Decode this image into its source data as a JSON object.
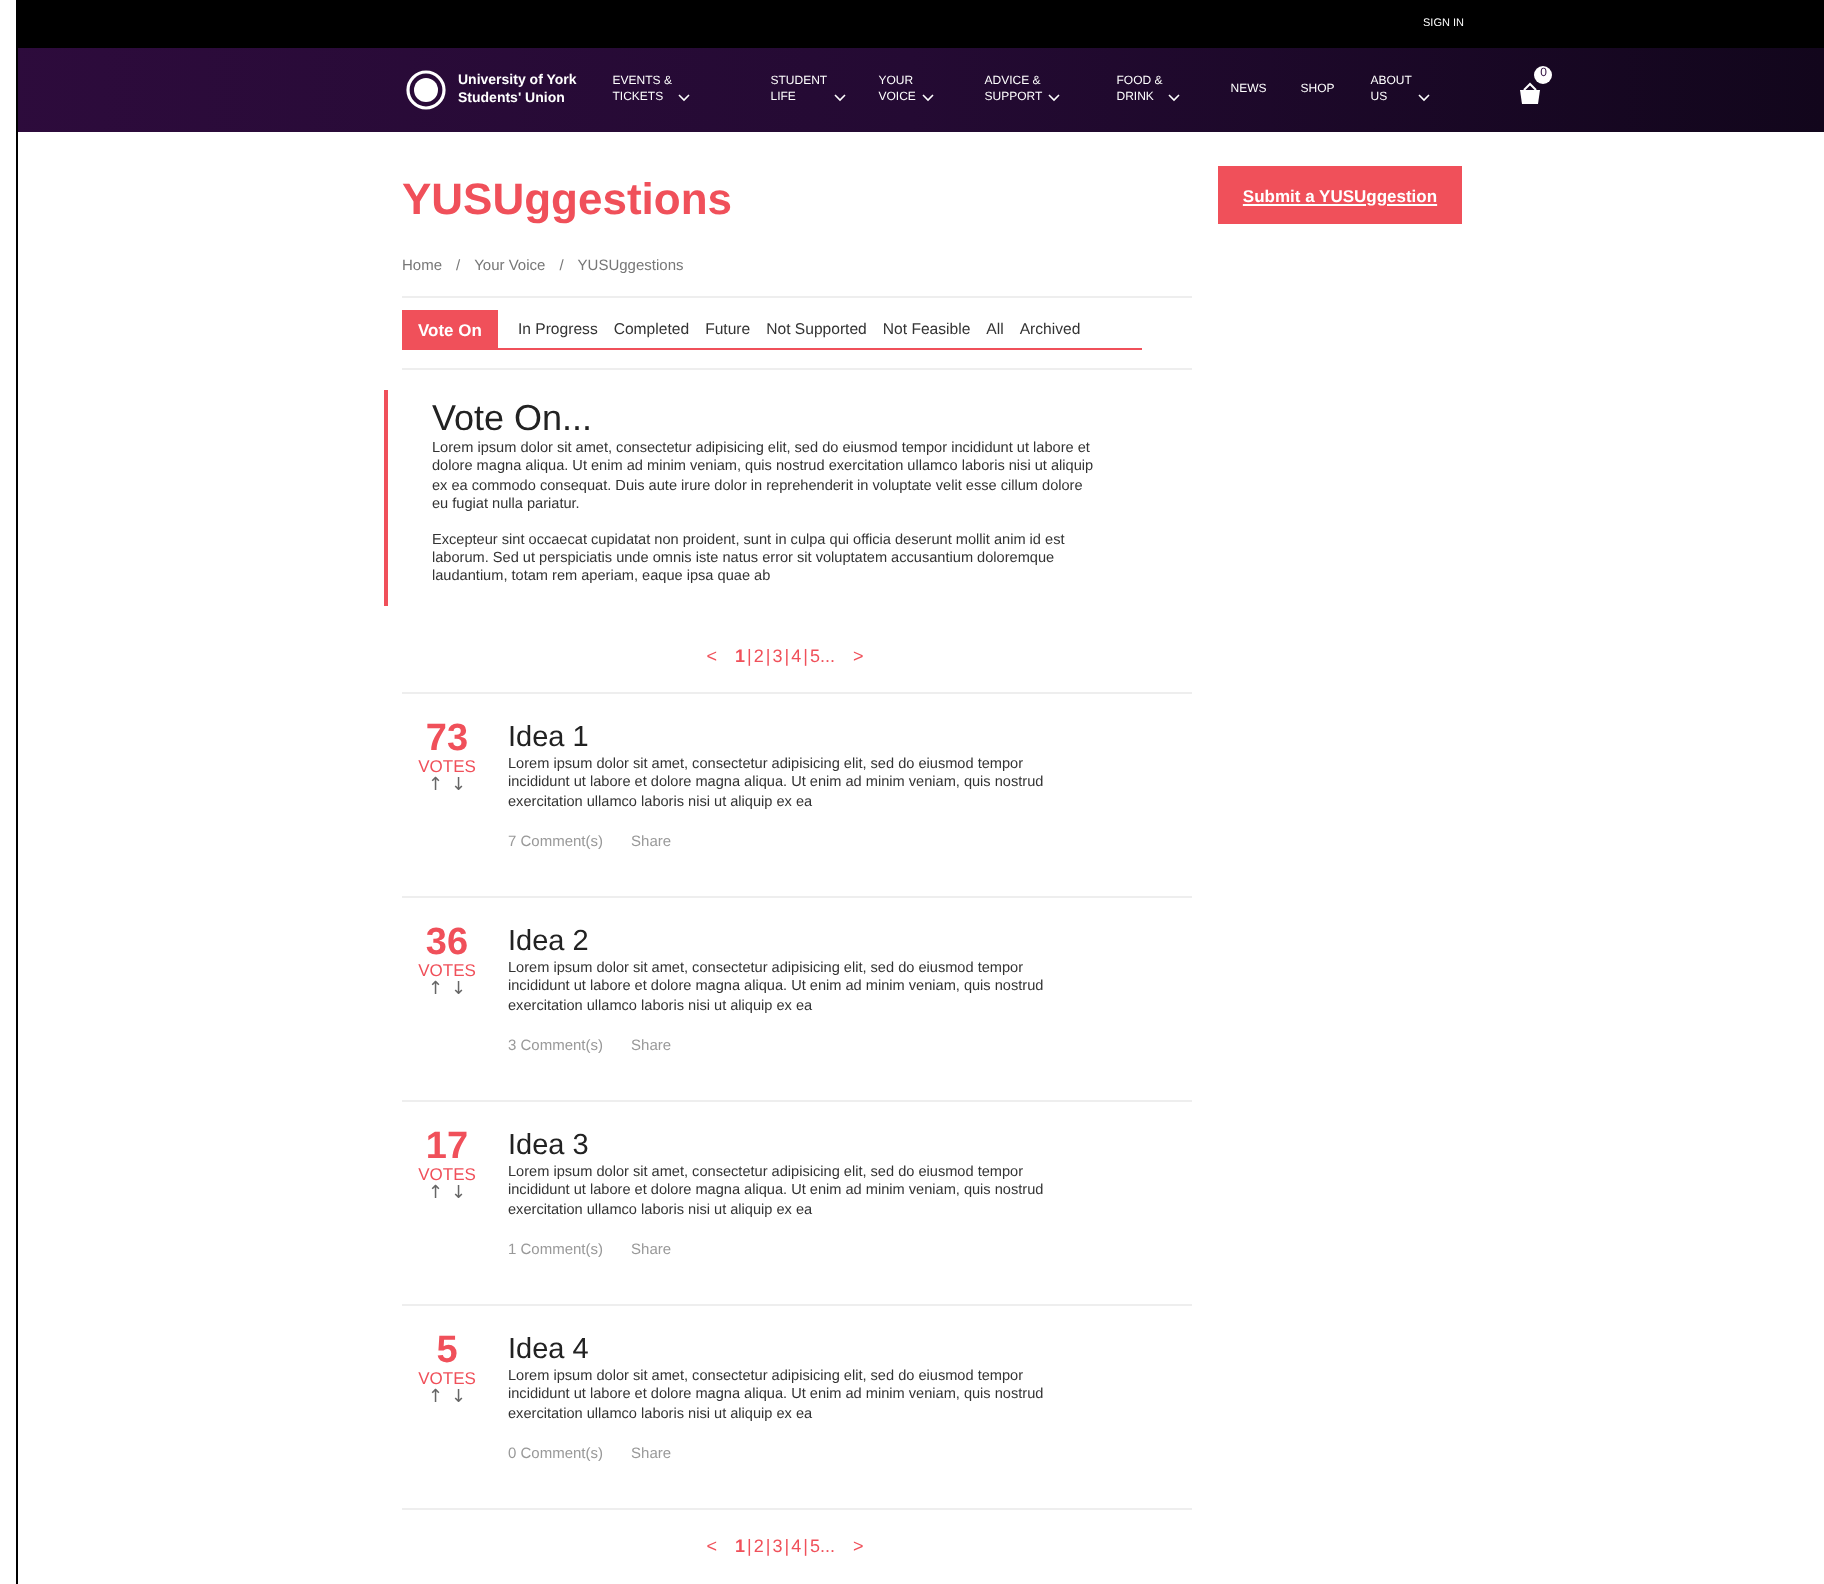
{
  "top_bar": {
    "sign_in": "SIGN IN"
  },
  "nav": {
    "brand": [
      "University of York",
      "Students' Union"
    ],
    "items": [
      {
        "lines": [
          "EVENTS &",
          "TICKETS"
        ],
        "dropdown": true
      },
      {
        "lines": [
          "STUDENT",
          "LIFE"
        ],
        "dropdown": true
      },
      {
        "lines": [
          "YOUR",
          "VOICE"
        ],
        "dropdown": true
      },
      {
        "lines": [
          "ADVICE &",
          "SUPPORT"
        ],
        "dropdown": true
      },
      {
        "lines": [
          "FOOD &",
          "DRINK"
        ],
        "dropdown": true
      },
      {
        "lines": [
          "NEWS"
        ],
        "dropdown": false
      },
      {
        "lines": [
          "SHOP"
        ],
        "dropdown": false
      },
      {
        "lines": [
          "ABOUT",
          "US"
        ],
        "dropdown": true
      }
    ],
    "cart_count": "0"
  },
  "page_title": "YUSUggestions",
  "breadcrumb": {
    "items": [
      "Home",
      "Your Voice",
      "YUSUggestions"
    ],
    "separator": "/"
  },
  "submit_button": "Submit a YUSUggestion",
  "tabs": [
    {
      "label": "Vote On",
      "selected": true
    },
    {
      "label": "In Progress",
      "selected": false
    },
    {
      "label": "Completed",
      "selected": false
    },
    {
      "label": "Future",
      "selected": false
    },
    {
      "label": "Not Supported",
      "selected": false
    },
    {
      "label": "Not Feasible",
      "selected": false
    },
    {
      "label": "All",
      "selected": false
    },
    {
      "label": "Archived",
      "selected": false
    }
  ],
  "intro": {
    "heading": "Vote On...",
    "paragraphs": [
      "Lorem ipsum dolor sit amet, consectetur adipisicing elit, sed do eiusmod tempor incididunt ut labore et dolore magna aliqua. Ut enim ad minim veniam, quis nostrud exercitation ullamco laboris nisi ut aliquip ex ea commodo consequat. Duis aute irure dolor in reprehenderit in voluptate velit esse cillum dolore eu fugiat nulla pariatur.",
      "Excepteur sint occaecat cupidatat non proident, sunt in culpa qui officia deserunt mollit anim id est laborum. Sed ut perspiciatis unde omnis iste natus error sit voluptatem accusantium doloremque laudantium, totam rem aperiam, eaque ipsa quae ab"
    ]
  },
  "pager_top": {
    "prev": "<",
    "next": ">",
    "separator": "|",
    "pages": [
      {
        "label": "1",
        "selected": true
      },
      {
        "label": "2",
        "selected": false
      },
      {
        "label": "3",
        "selected": false
      },
      {
        "label": "4",
        "selected": false
      },
      {
        "label": "5...",
        "selected": false
      }
    ]
  },
  "ideas": [
    {
      "votes": "73",
      "votes_label": "VOTES",
      "up": "↑",
      "down": "↓",
      "title": "Idea 1",
      "text": "Lorem ipsum dolor sit amet, consectetur adipisicing elit, sed do eiusmod tempor incididunt ut labore et dolore magna aliqua. Ut enim ad minim veniam, quis nostrud exercitation ullamco laboris nisi ut aliquip ex ea",
      "comments": "7 Comment(s)",
      "share": "Share"
    },
    {
      "votes": "36",
      "votes_label": "VOTES",
      "up": "↑",
      "down": "↓",
      "title": "Idea 2",
      "text": "Lorem ipsum dolor sit amet, consectetur adipisicing elit, sed do eiusmod tempor incididunt ut labore et dolore magna aliqua. Ut enim ad minim veniam, quis nostrud exercitation ullamco laboris nisi ut aliquip ex ea",
      "comments": "3 Comment(s)",
      "share": "Share"
    },
    {
      "votes": "17",
      "votes_label": "VOTES",
      "up": "↑",
      "down": "↓",
      "title": "Idea 3",
      "text": "Lorem ipsum dolor sit amet, consectetur adipisicing elit, sed do eiusmod tempor incididunt ut labore et dolore magna aliqua. Ut enim ad minim veniam, quis nostrud exercitation ullamco laboris nisi ut aliquip ex ea",
      "comments": "1 Comment(s)",
      "share": "Share"
    },
    {
      "votes": "5",
      "votes_label": "VOTES",
      "up": "↑",
      "down": "↓",
      "title": "Idea 4",
      "text": "Lorem ipsum dolor sit amet, consectetur adipisicing elit, sed do eiusmod tempor incididunt ut labore et dolore magna aliqua. Ut enim ad minim veniam, quis nostrud exercitation ullamco laboris nisi ut aliquip ex ea",
      "comments": "0 Comment(s)",
      "share": "Share"
    }
  ],
  "pager_bottom": {
    "prev": "<",
    "next": ">",
    "separator": "|",
    "pages": [
      {
        "label": "1",
        "selected": true
      },
      {
        "label": "2",
        "selected": false
      },
      {
        "label": "3",
        "selected": false
      },
      {
        "label": "4",
        "selected": false
      },
      {
        "label": "5...",
        "selected": false
      }
    ]
  }
}
